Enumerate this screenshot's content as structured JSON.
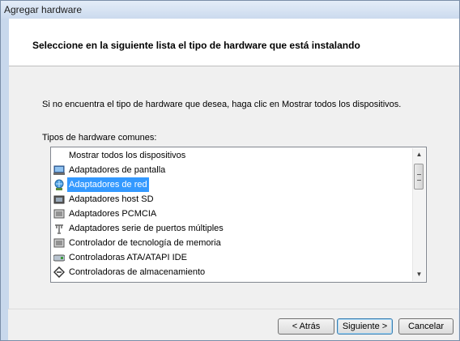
{
  "window": {
    "title": "Agregar hardware"
  },
  "header": {
    "text": "Seleccione en la siguiente lista el tipo de hardware que está instalando"
  },
  "content": {
    "instruction": "Si no encuentra el tipo de hardware que desea, haga clic en Mostrar todos los dispositivos.",
    "list_label": "Tipos de hardware comunes:",
    "items": [
      {
        "label": "Mostrar todos los dispositivos",
        "icon": "none"
      },
      {
        "label": "Adaptadores de pantalla",
        "icon": "display-adapter-icon"
      },
      {
        "label": "Adaptadores de red",
        "icon": "network-adapter-icon",
        "selected": true
      },
      {
        "label": "Adaptadores host SD",
        "icon": "sd-host-icon"
      },
      {
        "label": "Adaptadores PCMCIA",
        "icon": "pcmcia-icon"
      },
      {
        "label": "Adaptadores serie de puertos múltiples",
        "icon": "multiport-serial-icon"
      },
      {
        "label": "Controlador de tecnología de memoria",
        "icon": "memory-controller-icon"
      },
      {
        "label": "Controladoras ATA/ATAPI IDE",
        "icon": "ide-controller-icon"
      },
      {
        "label": "Controladoras de almacenamiento",
        "icon": "storage-controller-icon"
      }
    ]
  },
  "buttons": {
    "back": "< Atrás",
    "next": "Siguiente >",
    "cancel": "Cancelar"
  },
  "colors": {
    "selection": "#3399ff",
    "header_bg": "#ffffff",
    "body_bg": "#f0f0f0"
  }
}
